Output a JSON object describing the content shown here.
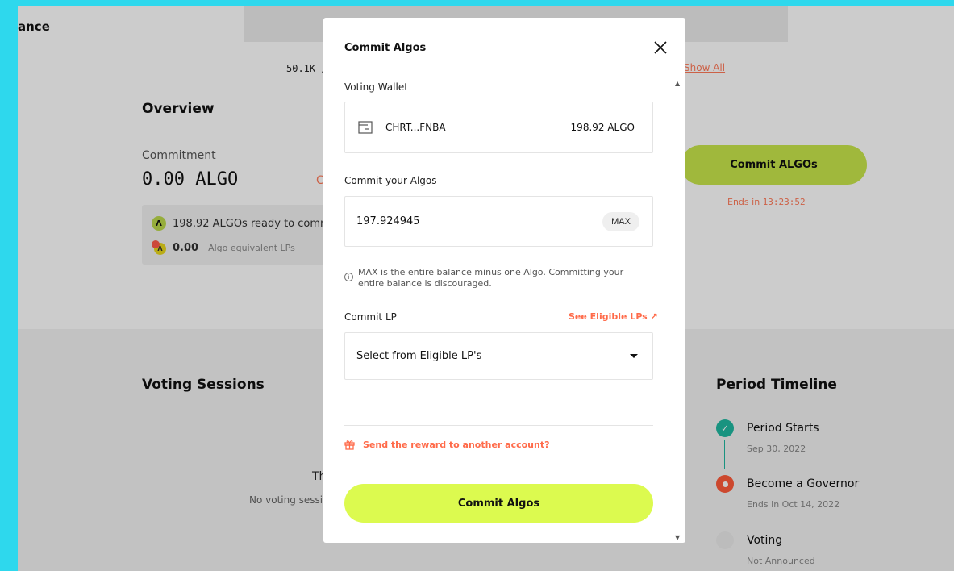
{
  "background": {
    "header_title": "ance",
    "stat_value": "50.1K /",
    "show_all": "Show All",
    "overview_title": "Overview",
    "commitment_label": "Commitment",
    "commitment_value": "0.00 ALGO",
    "red_fragment": "C",
    "ready_text": "198.92 ALGOs ready to comm",
    "lp_value": "0.00",
    "lp_note": "Algo equivalent LPs",
    "commit_button": "Commit ALGOs",
    "ends_prefix": "Ends in ",
    "ends_time": "13:23:52",
    "voting_title": "Voting Sessions",
    "th_fragment": "Th",
    "no_sessions": "No voting sessio",
    "period_title": "Period Timeline",
    "timeline": [
      {
        "name": "Period Starts",
        "sub": "Sep 30, 2022",
        "status": "done"
      },
      {
        "name": "Become a Governor",
        "sub": "Ends in Oct 14, 2022",
        "status": "active"
      },
      {
        "name": "Voting",
        "sub": "Not Announced",
        "status": "pending"
      }
    ]
  },
  "modal": {
    "title": "Commit Algos",
    "voting_wallet_label": "Voting Wallet",
    "wallet_address": "CHRT...FNBA",
    "wallet_balance": "198.92 ALGO",
    "commit_algos_label": "Commit your Algos",
    "amount_value": "197.924945",
    "max_label": "MAX",
    "info_text": "MAX is the entire balance minus one Algo. Committing your entire balance is discouraged.",
    "commit_lp_label": "Commit LP",
    "eligible_link": "See Eligible LPs ↗",
    "select_placeholder": "Select from Eligible LP's",
    "reward_link": "Send the reward to another account?",
    "submit_label": "Commit Algos"
  },
  "colors": {
    "accent_lime": "#dcfa4f",
    "accent_orange": "#ff6b4a",
    "frame_cyan": "#2ed8ed",
    "timeline_teal": "#20b8a0"
  }
}
